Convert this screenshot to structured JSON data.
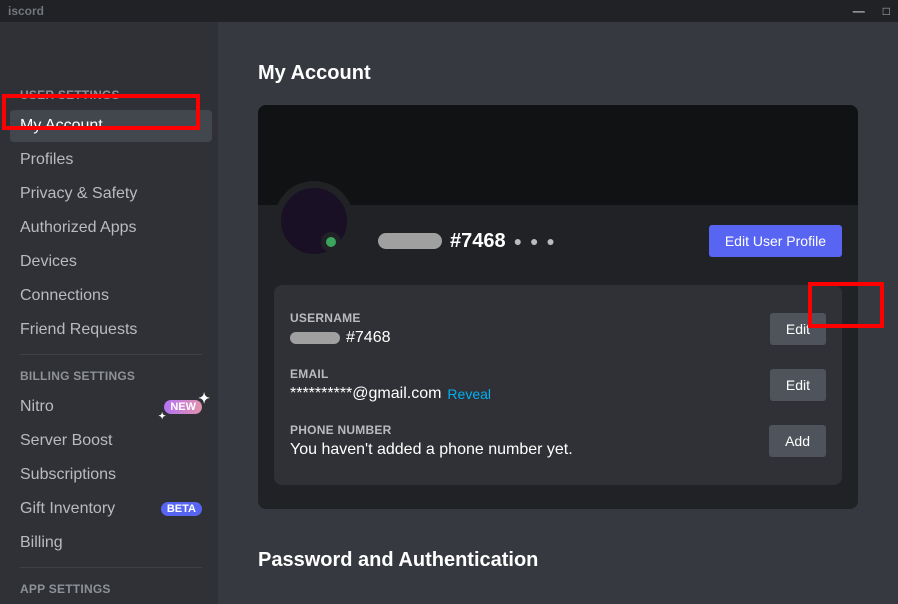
{
  "titlebar": {
    "app_name": "iscord"
  },
  "sidebar": {
    "sections": {
      "user": {
        "header": "USER SETTINGS",
        "items": [
          {
            "label": "My Account",
            "active": true
          },
          {
            "label": "Profiles"
          },
          {
            "label": "Privacy & Safety"
          },
          {
            "label": "Authorized Apps"
          },
          {
            "label": "Devices"
          },
          {
            "label": "Connections"
          },
          {
            "label": "Friend Requests"
          }
        ]
      },
      "billing": {
        "header": "BILLING SETTINGS",
        "items": [
          {
            "label": "Nitro",
            "badge": "NEW"
          },
          {
            "label": "Server Boost"
          },
          {
            "label": "Subscriptions"
          },
          {
            "label": "Gift Inventory",
            "badge": "BETA"
          },
          {
            "label": "Billing"
          }
        ]
      },
      "app": {
        "header": "APP SETTINGS"
      }
    }
  },
  "main": {
    "page_title": "My Account",
    "profile": {
      "discriminator": "#7468",
      "edit_profile_button": "Edit User Profile"
    },
    "fields": {
      "username": {
        "label": "USERNAME",
        "discriminator": "#7468",
        "button": "Edit"
      },
      "email": {
        "label": "EMAIL",
        "value": "**********@gmail.com",
        "reveal": "Reveal",
        "button": "Edit"
      },
      "phone": {
        "label": "PHONE NUMBER",
        "value": "You haven't added a phone number yet.",
        "button": "Add"
      }
    },
    "password_section_title": "Password and Authentication"
  }
}
